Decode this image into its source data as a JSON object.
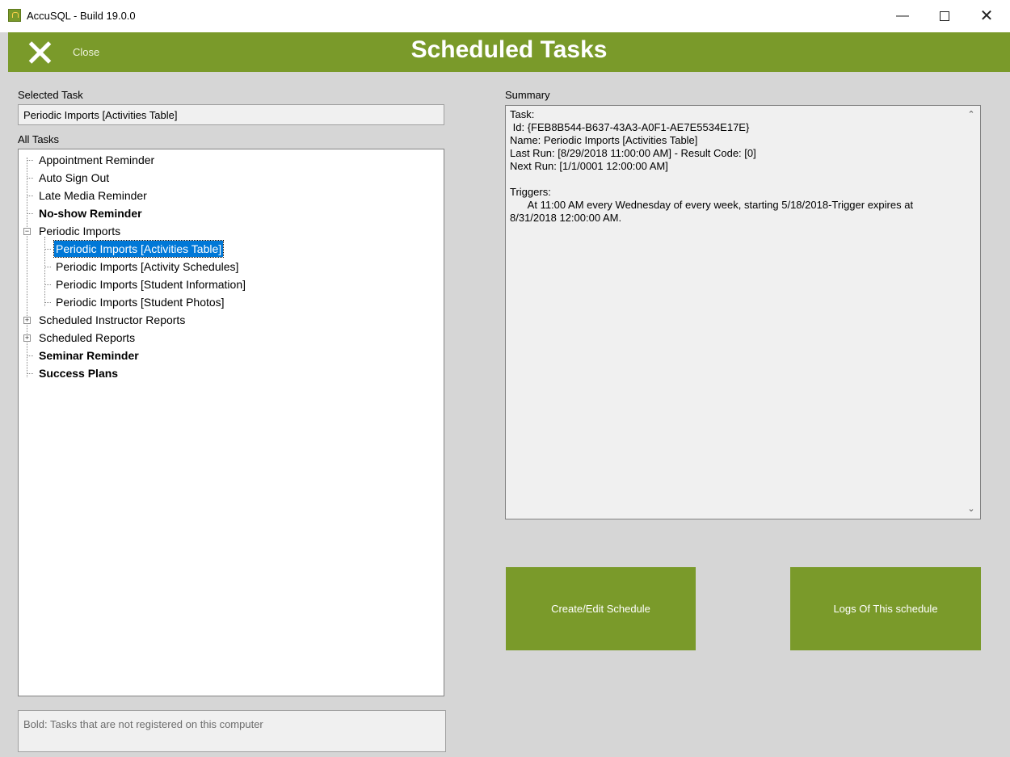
{
  "window": {
    "title": "AccuSQL - Build 19.0.0",
    "minimize_glyph": "—",
    "close_glyph": "✕"
  },
  "header": {
    "close_label": "Close",
    "title": "Scheduled Tasks"
  },
  "selected_task": {
    "label": "Selected Task",
    "value": "Periodic Imports [Activities Table]"
  },
  "all_tasks": {
    "label": "All Tasks",
    "items": [
      {
        "label": "Appointment Reminder",
        "bold": false
      },
      {
        "label": "Auto Sign Out",
        "bold": false
      },
      {
        "label": "Late Media Reminder",
        "bold": false
      },
      {
        "label": "No-show Reminder",
        "bold": true
      },
      {
        "label": "Periodic Imports",
        "bold": false,
        "expanded": true,
        "children": [
          {
            "label": "Periodic Imports [Activities Table]",
            "selected": true
          },
          {
            "label": "Periodic Imports [Activity Schedules]"
          },
          {
            "label": "Periodic Imports [Student Information]"
          },
          {
            "label": "Periodic Imports [Student Photos]"
          }
        ]
      },
      {
        "label": "Scheduled Instructor Reports",
        "bold": false,
        "expanded": false
      },
      {
        "label": "Scheduled Reports",
        "bold": false,
        "expanded": false
      },
      {
        "label": "Seminar Reminder",
        "bold": true
      },
      {
        "label": "Success Plans",
        "bold": true
      }
    ]
  },
  "legend": "Bold: Tasks that are not registered on this computer",
  "summary": {
    "label": "Summary",
    "text": "Task:\n Id: {FEB8B544-B637-43A3-A0F1-AE7E5534E17E}\nName: Periodic Imports [Activities Table]\nLast Run: [8/29/2018 11:00:00 AM] - Result Code: [0]\nNext Run: [1/1/0001 12:00:00 AM]\n\nTriggers:\n      At 11:00 AM every Wednesday of every week, starting 5/18/2018-Trigger expires at 8/31/2018 12:00:00 AM."
  },
  "buttons": {
    "create_edit": "Create/Edit Schedule",
    "logs": "Logs Of This schedule"
  },
  "colors": {
    "accent": "#7a9a2a",
    "selection": "#0078d7",
    "background": "#d6d6d6"
  }
}
